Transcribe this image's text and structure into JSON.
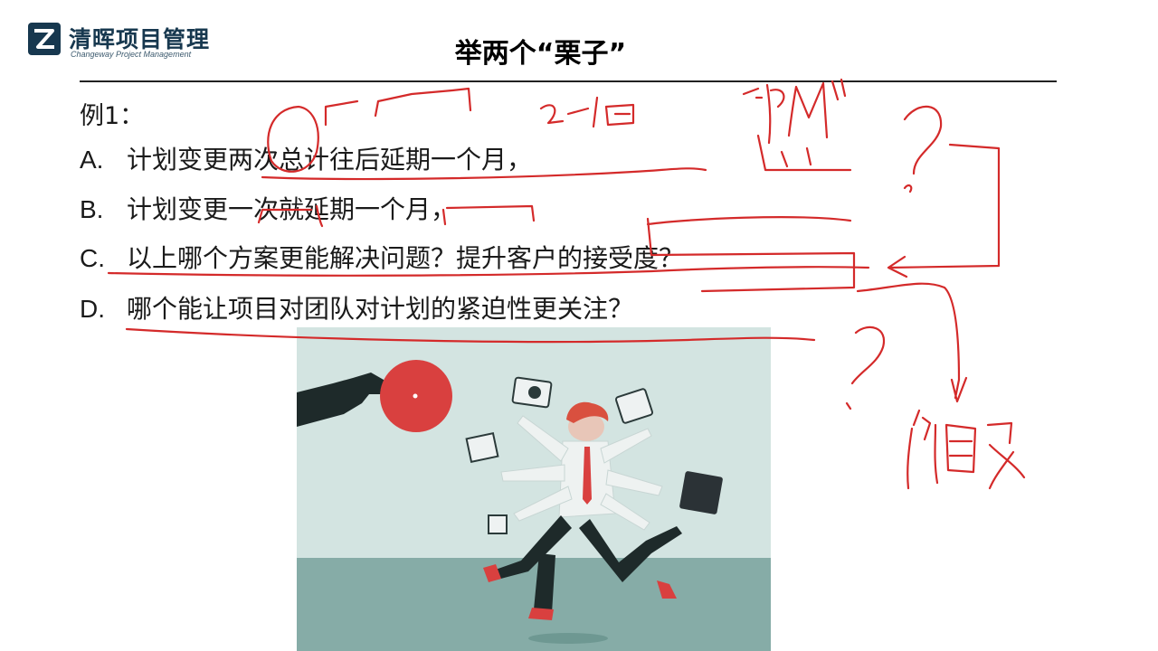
{
  "header": {
    "logo_cn": "清晖项目管理",
    "logo_en": "Changeway Project Management",
    "title": "举两个“栗子”"
  },
  "example": {
    "label": "例1：",
    "options": [
      {
        "key": "A.",
        "text": "计划变更两次总计往后延期一个月，"
      },
      {
        "key": "B.",
        "text": "计划变更一次就延期一个月，"
      },
      {
        "key": "C.",
        "text": "以上哪个方案更能解决问题？提升客户的接受度？"
      },
      {
        "key": "D.",
        "text": "哪个能让项目对团队对计划的紧迫性更关注？"
      }
    ]
  },
  "colors": {
    "ink": "#d42a2a",
    "brand": "#17384f",
    "illus_bg": "#cfe1de",
    "illus_ground": "#7fa7a2"
  },
  "illustration": {
    "icon": "stressed-multitasking-businessman-illustration"
  }
}
